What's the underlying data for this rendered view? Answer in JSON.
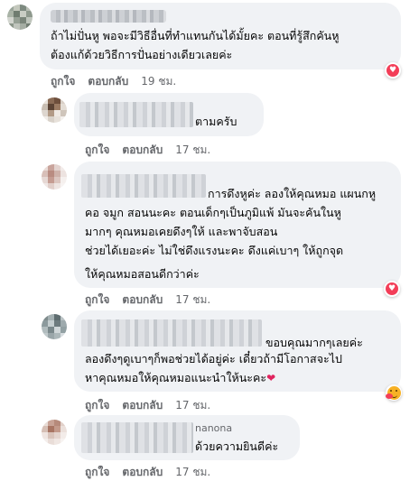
{
  "comments": [
    {
      "id": "c1",
      "lines": [
        "ถ้าไม่ปั่นหู พอจะมีวิธีอื่นที่ทำแทนกันได้มั้ยคะ ตอนที่รู้สึกคันหู",
        "ต้องแก้ด้วยวิธีการปั่นอย่างเดียวเลยค่ะ"
      ],
      "like_label": "ถูกใจ",
      "reply_label": "ตอบกลับ",
      "time": "19 ชม.",
      "reaction_icon": "heart-reaction-icon"
    },
    {
      "id": "c2",
      "lines": [
        "ตามครับ"
      ],
      "like_label": "ถูกใจ",
      "reply_label": "ตอบกลับ",
      "time": "17 ชม."
    },
    {
      "id": "c3",
      "lines": [
        "การดึงหูค่ะ ลองให้คุณหมอ แผนกหู",
        "คอ จมูก สอนนะคะ ตอนเด็กๆเป็นภูมิแพ้ มันจะคันในหู",
        "มากๆ คุณหมอเคยดึงๆให้ และพาจับสอน",
        "ช่วยได้เยอะค่ะ ไม่ใช่ดึงแรงนะคะ ดึงแค่เบาๆ ให้ถูกจุด",
        "ให้คุณหมอสอนดีกว่าค่ะ"
      ],
      "like_label": "ถูกใจ",
      "reply_label": "ตอบกลับ",
      "time": "17 ชม.",
      "reaction_icon": "heart-reaction-icon"
    },
    {
      "id": "c4",
      "lines": [
        "ขอบคุณมากๆเลยค่ะ",
        "ลองดึงๆดูเบาๆก็พอช่วยได้อยู่ค่ะ เดี๋ยวถ้ามีโอกาสจะไป",
        "หาคุณหมอให้คุณหมอแนะนำให้นะคะ"
      ],
      "inline_emoji": "❤",
      "like_label": "ถูกใจ",
      "reply_label": "ตอบกลับ",
      "time": "17 ชม.",
      "reaction_icon": "care-reaction-icon"
    },
    {
      "id": "c5",
      "partial_name": "nanona",
      "lines": [
        "ด้วยความยินดีค่ะ"
      ],
      "like_label": "ถูกใจ",
      "reply_label": "ตอบกลับ",
      "time": "17 ชม."
    }
  ]
}
